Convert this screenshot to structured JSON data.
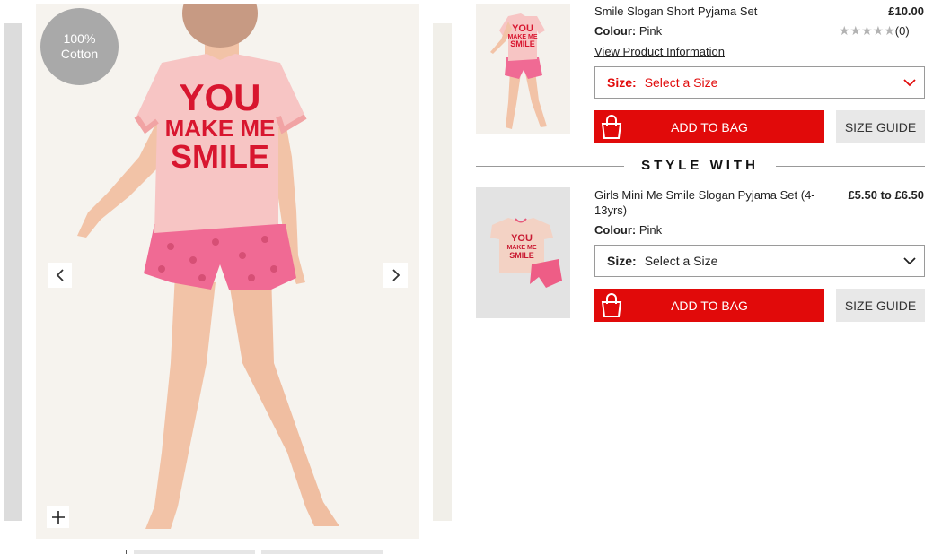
{
  "gallery": {
    "badge_line1": "100%",
    "badge_line2": "Cotton",
    "shirt_text": [
      "YOU",
      "MAKE ME",
      "SMILE"
    ],
    "prev_icon": "chevron-left-icon",
    "next_icon": "chevron-right-icon",
    "zoom_icon": "plus-icon"
  },
  "product": {
    "name": "Smile Slogan Short Pyjama Set",
    "price": "£10.00",
    "colour_label": "Colour:",
    "colour_value": "Pink",
    "rating_count": "(0)",
    "rating_stars": 0,
    "view_info": "View Product Information",
    "size_label": "Size:",
    "size_placeholder": "Select a Size",
    "add_to_bag": "ADD TO BAG",
    "size_guide": "SIZE GUIDE",
    "thumb_text": [
      "YOU",
      "MAKE ME",
      "SMILE"
    ]
  },
  "style_with": {
    "heading": "STYLE WITH"
  },
  "related": {
    "name": "Girls Mini Me Smile Slogan Pyjama Set (4-13yrs)",
    "price": "£5.50 to £6.50",
    "colour_label": "Colour:",
    "colour_value": "Pink",
    "size_label": "Size:",
    "size_placeholder": "Select a Size",
    "add_to_bag": "ADD TO BAG",
    "size_guide": "SIZE GUIDE",
    "thumb_text": [
      "YOU",
      "MAKE ME",
      "SMILE"
    ]
  },
  "colors": {
    "accent_red": "#e10a0a",
    "badge_grey": "#a9a9a9",
    "guide_grey": "#e8e8e8"
  }
}
